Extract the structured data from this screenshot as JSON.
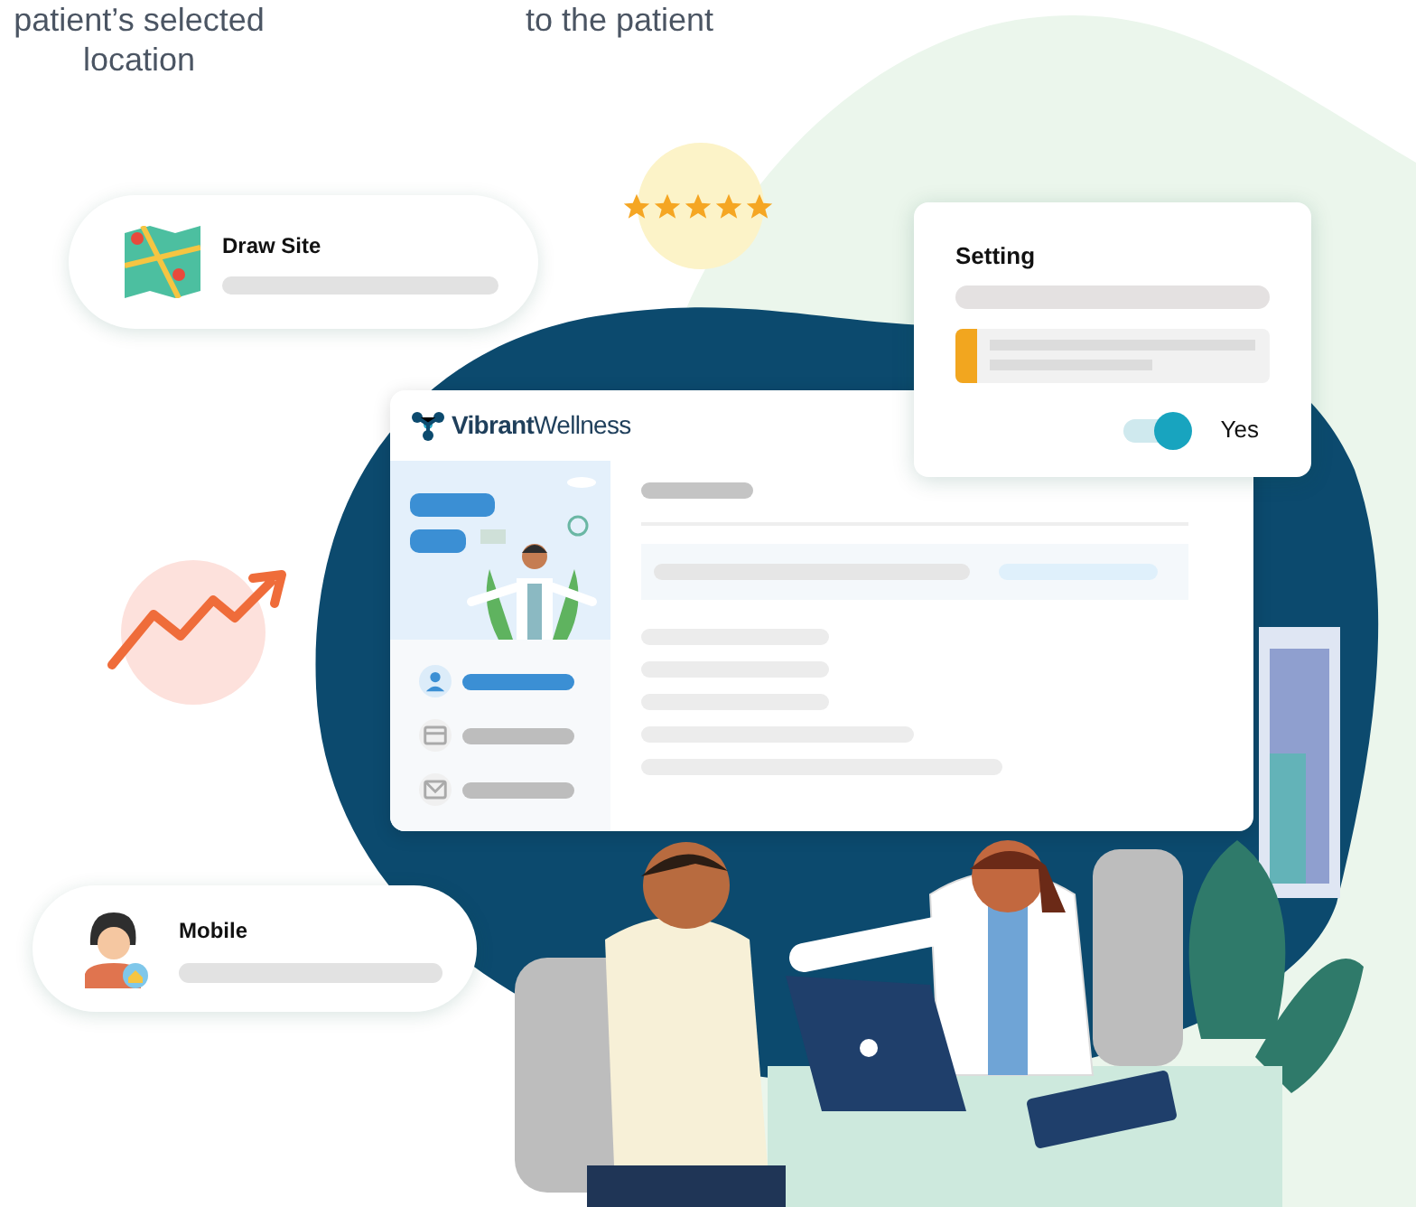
{
  "headings": [
    {
      "lines": [
        "patient’s selected",
        "location"
      ]
    },
    {
      "lines": [
        "to the patient"
      ]
    }
  ],
  "draw_site_card": {
    "title": "Draw Site"
  },
  "rating": {
    "stars": 5
  },
  "setting_card": {
    "title": "Setting",
    "toggle": {
      "on": true,
      "label": "Yes"
    }
  },
  "app_window": {
    "logo": "**Vibrant**Wellness",
    "nav": [
      {
        "selected": true
      },
      {
        "selected": false
      },
      {
        "selected": false
      }
    ]
  },
  "mobile_card": {
    "title": "Mobile"
  }
}
